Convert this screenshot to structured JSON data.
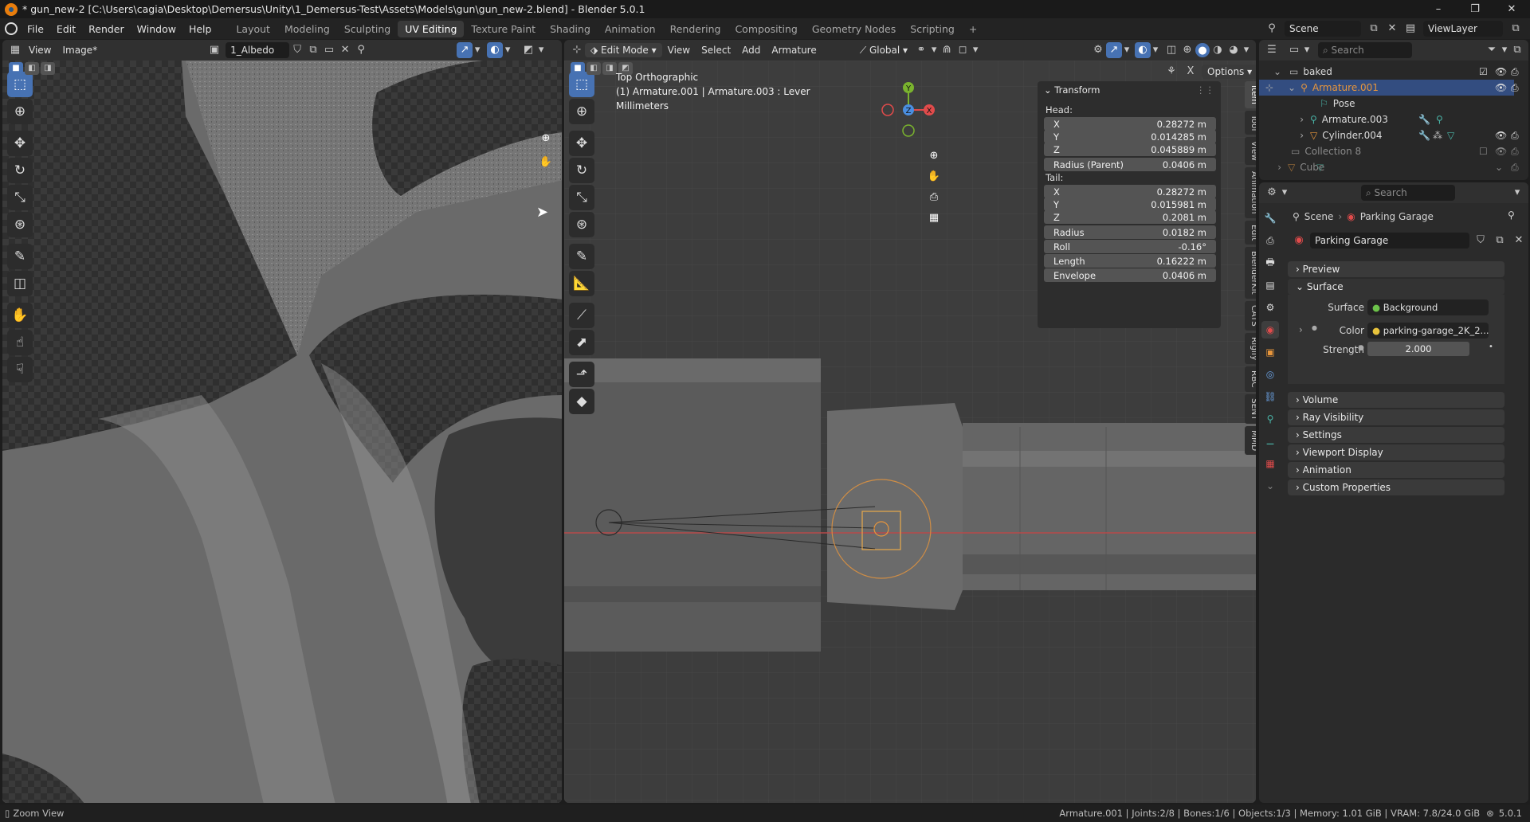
{
  "window": {
    "title": "* gun_new-2 [C:\\Users\\cagia\\Desktop\\Demersus\\Unity\\1_Demersus-Test\\Assets\\Models\\gun\\gun_new-2.blend] - Blender 5.0.1",
    "controls": {
      "minimize": "–",
      "maximize": "❐",
      "close": "✕"
    }
  },
  "menubar": {
    "menus": [
      "File",
      "Edit",
      "Render",
      "Window",
      "Help"
    ],
    "workspaces": [
      "Layout",
      "Modeling",
      "Sculpting",
      "UV Editing",
      "Texture Paint",
      "Shading",
      "Animation",
      "Rendering",
      "Compositing",
      "Geometry Nodes",
      "Scripting"
    ],
    "active_workspace": "UV Editing",
    "add_tab": "+",
    "scene_label": "Scene",
    "viewlayer_label": "ViewLayer"
  },
  "image_editor": {
    "menus": [
      "View",
      "Image*"
    ],
    "image_name": "1_Albedo"
  },
  "viewport": {
    "mode": "Edit Mode",
    "menus": [
      "View",
      "Select",
      "Add",
      "Armature"
    ],
    "orientation": "Global",
    "options_label": "Options",
    "view_name": "Top Orthographic",
    "object_info": "(1) Armature.001 | Armature.003 : Lever",
    "units": "Millimeters",
    "gizmo_axes": {
      "x": "X",
      "y": "Y",
      "z": "Z"
    }
  },
  "transform_panel": {
    "title": "Transform",
    "head_label": "Head:",
    "head": [
      {
        "label": "X",
        "value": "0.28272 m"
      },
      {
        "label": "Y",
        "value": "0.014285 m"
      },
      {
        "label": "Z",
        "value": "0.045889 m"
      }
    ],
    "radius_parent": {
      "label": "Radius (Parent)",
      "value": "0.0406 m"
    },
    "tail_label": "Tail:",
    "tail": [
      {
        "label": "X",
        "value": "0.28272 m"
      },
      {
        "label": "Y",
        "value": "0.015981 m"
      },
      {
        "label": "Z",
        "value": "0.2081 m"
      }
    ],
    "extra": [
      {
        "label": "Radius",
        "value": "0.0182 m"
      },
      {
        "label": "Roll",
        "value": "-0.16°"
      },
      {
        "label": "Length",
        "value": "0.16222 m"
      },
      {
        "label": "Envelope",
        "value": "0.0406 m"
      }
    ]
  },
  "side_tabs": [
    "Item",
    "Tool",
    "View",
    "Animation",
    "Edit",
    "BlenderKit",
    "CATS",
    "Rigify",
    "RBC",
    "SENT",
    "MMD"
  ],
  "outliner": {
    "search_placeholder": "Search",
    "rows": [
      {
        "label": "baked",
        "type": "collection"
      },
      {
        "label": "Armature.001",
        "type": "armature",
        "selected": true
      },
      {
        "label": "Pose",
        "type": "pose"
      },
      {
        "label": "Armature.003",
        "type": "armature"
      },
      {
        "label": "Cylinder.004",
        "type": "mesh"
      },
      {
        "label": "Collection 8",
        "type": "collection",
        "dim": true
      },
      {
        "label": "Cube",
        "type": "mesh",
        "dim": true
      }
    ]
  },
  "properties": {
    "search_placeholder": "Search",
    "breadcrumb": {
      "scene": "Scene",
      "world": "Parking Garage"
    },
    "world_name": "Parking Garage",
    "sections": {
      "preview": "Preview",
      "surface": "Surface",
      "volume": "Volume",
      "ray_visibility": "Ray Visibility",
      "settings": "Settings",
      "viewport_display": "Viewport Display",
      "animation": "Animation",
      "custom_properties": "Custom Properties"
    },
    "surface": {
      "surface_label": "Surface",
      "surface_value": "Background",
      "color_label": "Color",
      "color_value": "parking-garage_2K_2...",
      "strength_label": "Strength",
      "strength_value": "2.000"
    }
  },
  "statusbar": {
    "left": "Zoom View",
    "right": "Armature.001 | Joints:2/8 | Bones:1/6 | Objects:1/3 | Memory: 1.01 GiB | VRAM: 7.8/24.0 GiB",
    "version": "5.0.1"
  },
  "colors": {
    "accent": "#4772b3",
    "selected_row": "#334d80",
    "x_axis": "#e04b4b",
    "y_axis": "#7ab32e",
    "z_axis": "#4a8ee0",
    "armature_orange": "#e8963c"
  }
}
